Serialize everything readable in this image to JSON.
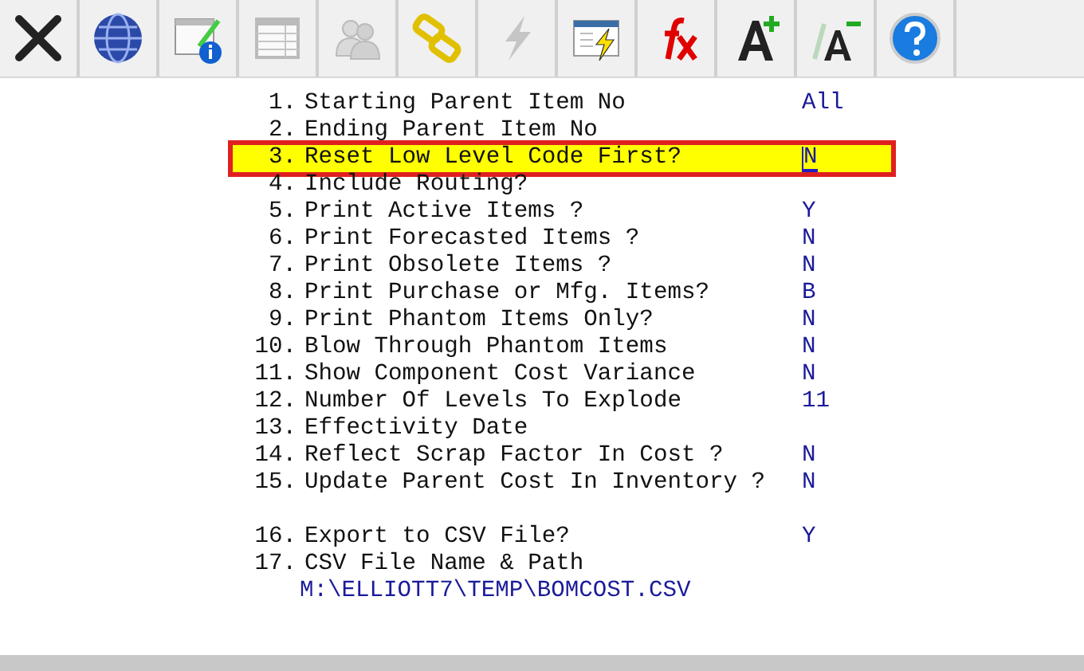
{
  "toolbar": [
    {
      "kind": "close",
      "disabled": false
    },
    {
      "kind": "globe",
      "disabled": false
    },
    {
      "kind": "info",
      "disabled": false
    },
    {
      "kind": "table",
      "disabled": true
    },
    {
      "kind": "users",
      "disabled": true
    },
    {
      "kind": "link",
      "disabled": false
    },
    {
      "kind": "bolt",
      "disabled": true
    },
    {
      "kind": "window-bolt",
      "disabled": false
    },
    {
      "kind": "fx",
      "disabled": false
    },
    {
      "kind": "font-up",
      "disabled": false
    },
    {
      "kind": "font-down",
      "disabled": false
    },
    {
      "kind": "help",
      "disabled": false
    }
  ],
  "sections": [
    [
      {
        "number": "1.",
        "label": "Starting Parent Item No",
        "value": "All",
        "selected": false
      },
      {
        "number": "2.",
        "label": "Ending Parent Item No",
        "selected": false
      },
      {
        "number": "3.",
        "label": "Reset Low Level Code First?",
        "value": "N",
        "selected": true
      },
      {
        "number": "4.",
        "label": "Include Routing?",
        "selected": false
      },
      {
        "number": "5.",
        "label": "Print Active Items ?",
        "value": "Y",
        "selected": false
      },
      {
        "number": "6.",
        "label": "Print Forecasted Items ?",
        "value": "N",
        "selected": false
      },
      {
        "number": "7.",
        "label": "Print Obsolete Items ?",
        "value": "N",
        "selected": false
      },
      {
        "number": "8.",
        "label": "Print Purchase or Mfg. Items?",
        "value": "B",
        "selected": false
      },
      {
        "number": "9.",
        "label": "Print Phantom Items Only?",
        "value": "N",
        "selected": false
      },
      {
        "number": "10.",
        "label": "Blow Through Phantom Items",
        "value": "N",
        "selected": false
      },
      {
        "number": "11.",
        "label": "Show Component Cost Variance",
        "value": "N",
        "selected": false
      },
      {
        "number": "12.",
        "label": "Number Of Levels To Explode",
        "value": "11",
        "selected": false
      },
      {
        "number": "13.",
        "label": "Effectivity Date",
        "selected": false
      },
      {
        "number": "14.",
        "label": "Reflect Scrap Factor In Cost ?",
        "value": "N",
        "selected": false
      },
      {
        "number": "15.",
        "label": "Update Parent Cost In Inventory ?",
        "value": "N",
        "selected": false
      }
    ],
    [
      {
        "number": "16.",
        "label": "Export to CSV File?",
        "value": "Y",
        "selected": false
      },
      {
        "number": "17.",
        "label": "CSV File Name & Path",
        "path": "M:\\ELLIOTT7\\TEMP\\BOMCOST.CSV",
        "selected": false
      }
    ]
  ]
}
